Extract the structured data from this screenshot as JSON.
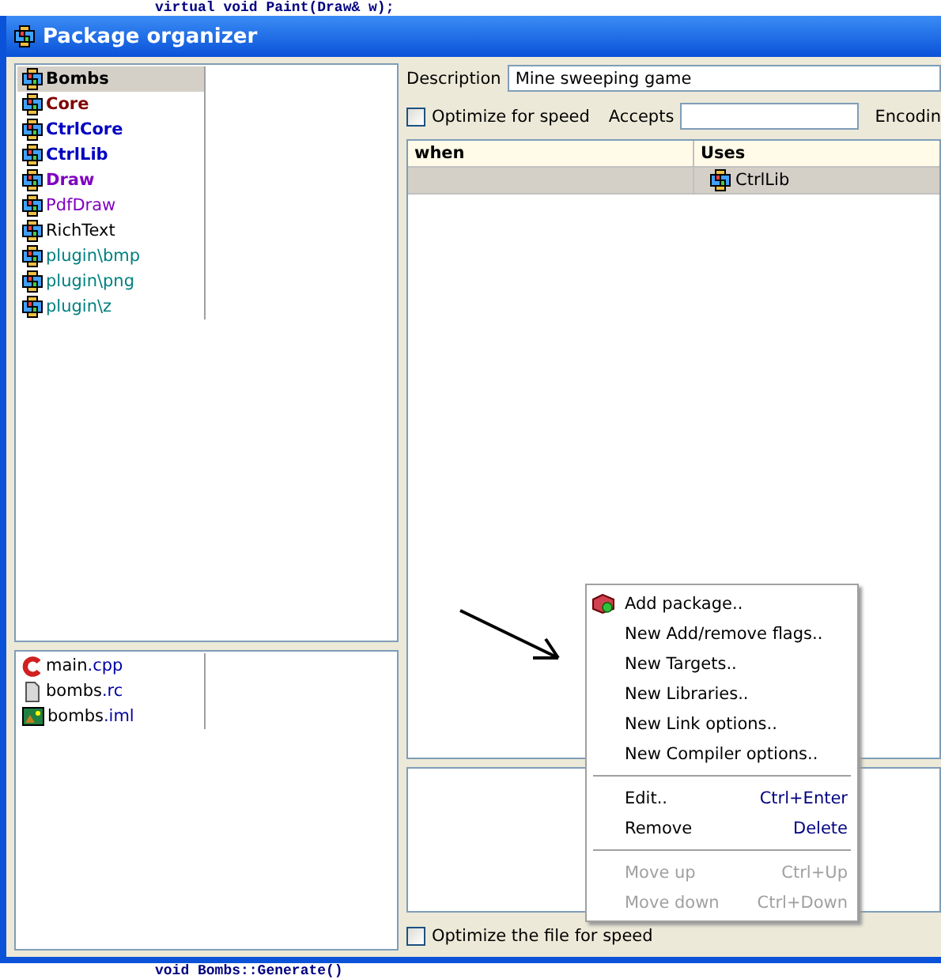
{
  "background_code": {
    "top": "virtual void Paint(Draw& w);",
    "bottom": "void Bombs::Generate()"
  },
  "window": {
    "title": "Package organizer"
  },
  "packages": [
    {
      "name": "Bombs",
      "bold": true,
      "color": "#000000",
      "selected": true
    },
    {
      "name": "Core",
      "bold": true,
      "color": "#800000",
      "selected": false
    },
    {
      "name": "CtrlCore",
      "bold": true,
      "color": "#0000c0",
      "selected": false
    },
    {
      "name": "CtrlLib",
      "bold": true,
      "color": "#0000c0",
      "selected": false
    },
    {
      "name": "Draw",
      "bold": true,
      "color": "#8000c0",
      "selected": false
    },
    {
      "name": "PdfDraw",
      "bold": false,
      "color": "#8000c0",
      "selected": false
    },
    {
      "name": "RichText",
      "bold": false,
      "color": "#000000",
      "selected": false
    },
    {
      "name": "plugin\\bmp",
      "bold": false,
      "color": "#008080",
      "selected": false
    },
    {
      "name": "plugin\\png",
      "bold": false,
      "color": "#008080",
      "selected": false
    },
    {
      "name": "plugin\\z",
      "bold": false,
      "color": "#008080",
      "selected": false
    }
  ],
  "files": [
    {
      "kind": "cpp",
      "name": "main",
      "ext": ".cpp"
    },
    {
      "kind": "rc",
      "name": "bombs",
      "ext": ".rc"
    },
    {
      "kind": "iml",
      "name": "bombs",
      "ext": ".iml"
    }
  ],
  "description": {
    "label": "Description",
    "value": "Mine sweeping game"
  },
  "optimize": {
    "label": "Optimize for speed",
    "checked": false
  },
  "accepts": {
    "label": "Accepts"
  },
  "encoding": {
    "label": "Encodin"
  },
  "uses_table": {
    "columns": [
      "when",
      "Uses"
    ],
    "rows": [
      {
        "when": "",
        "uses": "CtrlLib",
        "selected": true
      }
    ]
  },
  "file_optimize": {
    "label": "Optimize the file for speed",
    "checked": false
  },
  "context_menu": [
    {
      "kind": "item",
      "label": "Add package..",
      "icon": true,
      "disabled": false
    },
    {
      "kind": "item",
      "label": "New Add/remove flags..",
      "disabled": false
    },
    {
      "kind": "item",
      "label": "New Targets..",
      "disabled": false
    },
    {
      "kind": "item",
      "label": "New Libraries..",
      "disabled": false
    },
    {
      "kind": "item",
      "label": "New Link options..",
      "disabled": false
    },
    {
      "kind": "item",
      "label": "New Compiler options..",
      "disabled": false
    },
    {
      "kind": "separator"
    },
    {
      "kind": "item",
      "label": "Edit..",
      "shortcut": "Ctrl+Enter",
      "disabled": false
    },
    {
      "kind": "item",
      "label": "Remove",
      "shortcut": "Delete",
      "disabled": false
    },
    {
      "kind": "separator"
    },
    {
      "kind": "item",
      "label": "Move up",
      "shortcut": "Ctrl+Up",
      "disabled": true
    },
    {
      "kind": "item",
      "label": "Move down",
      "shortcut": "Ctrl+Down",
      "disabled": true
    }
  ]
}
